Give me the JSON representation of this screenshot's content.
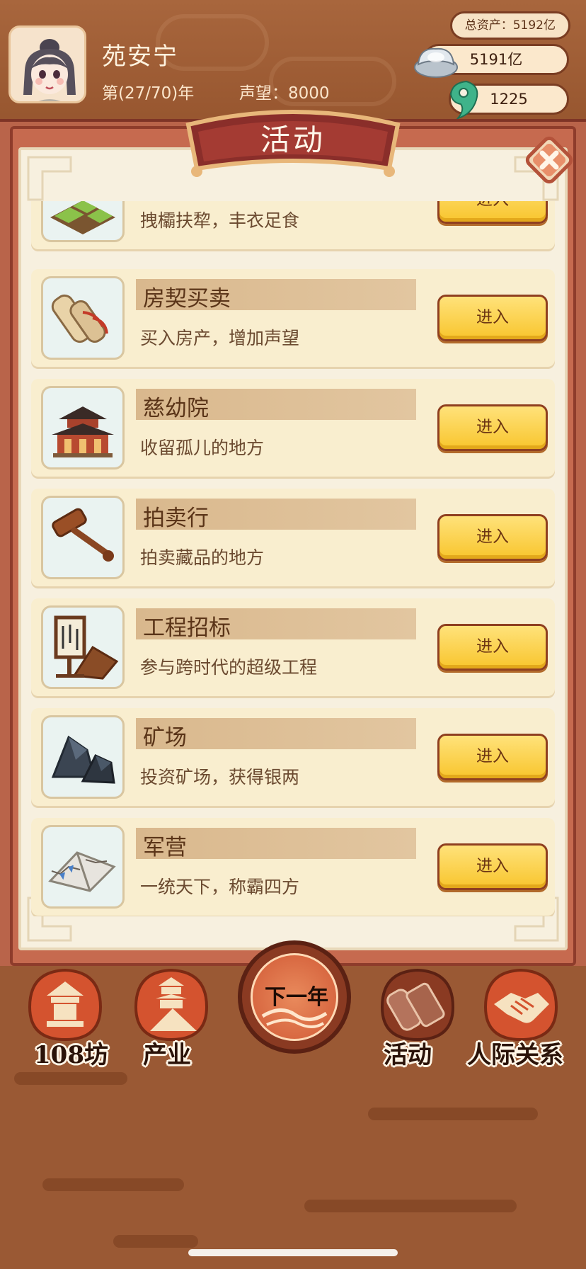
{
  "header": {
    "player_name": "苑安宁",
    "year_text": "第(27/70)年",
    "fame_text": "声望：8000",
    "total_assets": "总资产：5192亿",
    "silver": "5191亿",
    "jade": "1225"
  },
  "panel": {
    "title": "活动"
  },
  "activities": [
    {
      "title": "",
      "desc": "拽欛扶犂，丰衣足食",
      "button": "进入",
      "icon": "farmland-icon"
    },
    {
      "title": "房契买卖",
      "desc": "买入房产，增加声望",
      "button": "进入",
      "icon": "scroll-deed-icon"
    },
    {
      "title": "慈幼院",
      "desc": "收留孤儿的地方",
      "button": "进入",
      "icon": "temple-building-icon"
    },
    {
      "title": "拍卖行",
      "desc": "拍卖藏品的地方",
      "button": "进入",
      "icon": "gavel-icon"
    },
    {
      "title": "工程招标",
      "desc": "参与跨时代的超级工程",
      "button": "进入",
      "icon": "notice-board-icon"
    },
    {
      "title": "矿场",
      "desc": "投资矿场，获得银两",
      "button": "进入",
      "icon": "ore-rock-icon"
    },
    {
      "title": "军营",
      "desc": "一统天下，称霸四方",
      "button": "进入",
      "icon": "tent-icon"
    }
  ],
  "nav": {
    "fang": "108坊",
    "industry": "产业",
    "next_year": "下一年",
    "activity": "活动",
    "relations": "人际关系"
  },
  "colors": {
    "accent_red": "#c66a4f",
    "button_gold": "#f8c52d",
    "panel_cream": "#f7f0df"
  }
}
